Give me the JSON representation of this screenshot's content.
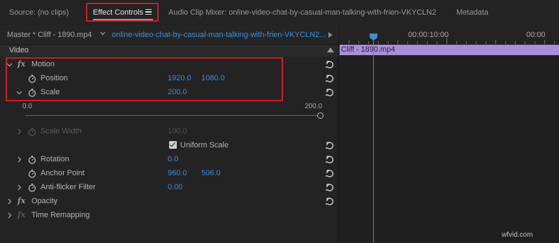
{
  "tabs": [
    {
      "label": "Source: (no clips)"
    },
    {
      "label": "Effect Controls"
    },
    {
      "label": "Audio Clip Mixer: online-video-chat-by-casual-man-talking-with-frien-VKYCLN2"
    },
    {
      "label": "Metadata"
    }
  ],
  "clip_header": {
    "master_label": "Master * Cliff - 1890.mp4",
    "sequence_name": "online-video-chat-by-casual-man-talking-with-frien-VKYCLN2..."
  },
  "section": {
    "video_label": "Video"
  },
  "effects": {
    "motion": {
      "label": "Motion",
      "position": {
        "label": "Position",
        "x": "1920.0",
        "y": "1080.0"
      },
      "scale": {
        "label": "Scale",
        "value": "200.0",
        "slider_min": "0.0",
        "slider_max": "200.0"
      },
      "scale_width": {
        "label": "Scale Width",
        "value": "100.0"
      },
      "uniform_scale": {
        "label": "Uniform Scale",
        "checked": true
      },
      "rotation": {
        "label": "Rotation",
        "value": "0.0"
      },
      "anchor_point": {
        "label": "Anchor Point",
        "x": "960.0",
        "y": "506.0"
      },
      "anti_flicker": {
        "label": "Anti-flicker Filter",
        "value": "0.00"
      }
    },
    "opacity": {
      "label": "Opacity"
    },
    "time_remapping": {
      "label": "Time Remapping"
    }
  },
  "timeline": {
    "timecode_1": "00:00:10:00",
    "timecode_2": "00:00",
    "clip_label": "Cliff - 1890.mp4"
  },
  "watermark": "wfvid.com",
  "colors": {
    "accent_blue": "#3e8ed8",
    "clip_purple": "#a98ed8",
    "highlight_red": "#d11b28"
  },
  "icons": [
    "hamburger-menu-icon",
    "chevron-down-icon",
    "play-triangle-icon",
    "collapse-triangle-icon",
    "fx-icon",
    "stopwatch-icon",
    "reset-icon",
    "chevron-right-icon",
    "checkbox-checked-icon",
    "playhead-icon"
  ]
}
